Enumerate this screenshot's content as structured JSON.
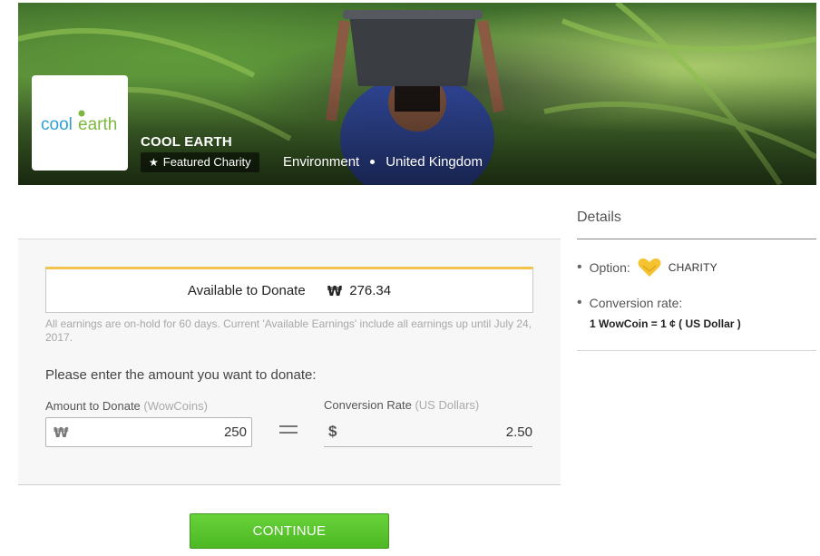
{
  "banner": {
    "logo_text_a": "cool",
    "logo_text_b": "earth",
    "charity_name": "COOL EARTH",
    "featured_label": "Featured Charity",
    "category": "Environment",
    "location": "United Kingdom"
  },
  "donate": {
    "available_label": "Available to Donate",
    "currency_symbol": "₩",
    "available_amount": "276.34",
    "note": "All earnings are on-hold for 60 days. Current 'Available Earnings' include all earnings up until July 24, 2017.",
    "prompt": "Please enter the amount you want to donate:",
    "amount_label": "Amount to Donate",
    "amount_unit": "(WowCoins)",
    "amount_value": "250",
    "conversion_label": "Conversion Rate",
    "conversion_unit": "(US Dollars)",
    "dollar_symbol": "$",
    "conversion_value": "2.50"
  },
  "continue_label": "CONTINUE",
  "details": {
    "title": "Details",
    "option_label": "Option:",
    "option_value": "CHARITY",
    "conversion_label": "Conversion rate:",
    "conversion_value": "1 WowCoin = 1 ¢ ( US Dollar )"
  },
  "colors": {
    "accent_gold": "#f2c44e",
    "button_green": "#52bd27",
    "logo_blue": "#2f9fd6",
    "logo_green": "#7cb83f"
  }
}
